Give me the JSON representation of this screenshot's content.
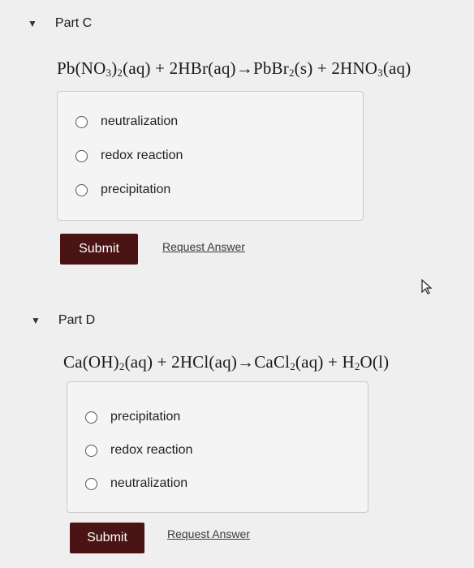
{
  "part_c": {
    "toggle_glyph": "▼",
    "title": "Part C",
    "equation": {
      "p1": "Pb(NO",
      "s1": "3",
      "p2": ")",
      "s2": "2",
      "p3": "(aq) + 2HBr(aq)→PbBr",
      "s3": "2",
      "p4": "(s) + 2HNO",
      "s4": "3",
      "p5": "(aq)"
    },
    "choices": [
      "neutralization",
      "redox reaction",
      "precipitation"
    ],
    "submit_label": "Submit",
    "request_label": "Request Answer"
  },
  "part_d": {
    "toggle_glyph": "▼",
    "title": "Part D",
    "equation": {
      "p1": "Ca(OH)",
      "s1": "2",
      "p2": "(aq) + 2HCl(aq)→CaCl",
      "s2": "2",
      "p3": "(aq) + H",
      "s3": "2",
      "p4": "O(l)"
    },
    "choices": [
      "precipitation",
      "redox reaction",
      "neutralization"
    ],
    "submit_label": "Submit",
    "request_label": "Request Answer"
  },
  "colors": {
    "submit_bg": "#4a1414",
    "page_bg": "#efefef"
  },
  "icons": {
    "cursor": "mouse-pointer-icon"
  }
}
